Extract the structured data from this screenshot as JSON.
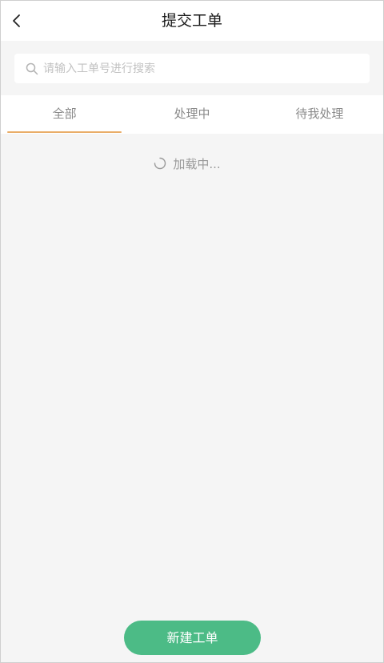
{
  "header": {
    "back_icon": "chevron-left-icon",
    "title": "提交工单"
  },
  "search": {
    "icon": "search-icon",
    "placeholder": "请输入工单号进行搜索",
    "value": ""
  },
  "tabs": [
    {
      "label": "全部",
      "active": true
    },
    {
      "label": "处理中",
      "active": false
    },
    {
      "label": "待我处理",
      "active": false
    }
  ],
  "colors": {
    "accent_underline": "#e9ad67",
    "primary_button": "#4cbb86",
    "background": "#f5f5f5"
  },
  "loading": {
    "icon": "spinner-icon",
    "text": "加载中..."
  },
  "footer": {
    "new_ticket_label": "新建工单"
  }
}
